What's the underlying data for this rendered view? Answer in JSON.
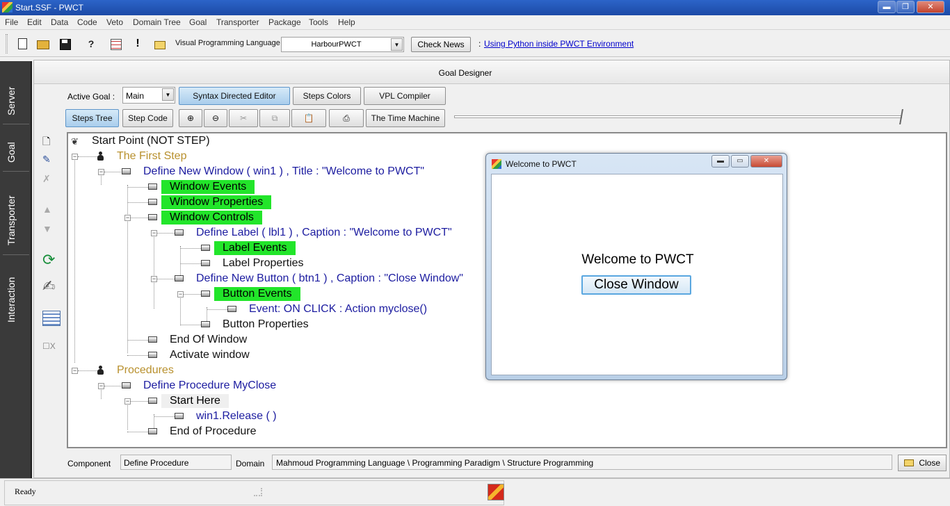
{
  "window": {
    "title": "Start.SSF  - PWCT",
    "min": "▬",
    "max": "❐",
    "close": "✕"
  },
  "menu": [
    "File",
    "Edit",
    "Data",
    "Code",
    "Veto",
    "Domain Tree",
    "Goal",
    "Transporter",
    "Package",
    "Tools",
    "Help"
  ],
  "toolbar": {
    "vpl_label": "Visual Programming Language",
    "vpl_value": "HarbourPWCT",
    "check_news": "Check News",
    "news_colon": ":",
    "news_link": "Using Python inside PWCT Environment"
  },
  "side_tabs": [
    "Server",
    "Goal",
    "Transporter",
    "Interaction"
  ],
  "goal_designer": {
    "title": "Goal Designer",
    "active_goal_label": "Active Goal :",
    "active_goal_value": "Main",
    "buttons_row1": [
      "Syntax Directed Editor",
      "Steps Colors",
      "VPL Compiler"
    ],
    "steps_tree": "Steps Tree",
    "step_code": "Step Code",
    "time_machine": "The Time Machine"
  },
  "tree": [
    {
      "text": "Start Point (NOT STEP)",
      "style": "black"
    },
    {
      "text": "The First Step",
      "style": "gold"
    },
    {
      "text": "Define New Window  ( win1 ) , Title : \"Welcome to PWCT\"",
      "style": "blue"
    },
    {
      "text": "Window Events",
      "style": "green"
    },
    {
      "text": "Window Properties",
      "style": "green"
    },
    {
      "text": "Window Controls",
      "style": "green"
    },
    {
      "text": "Define Label ( lbl1 ) , Caption : \"Welcome to PWCT\"",
      "style": "blue"
    },
    {
      "text": "Label Events",
      "style": "green"
    },
    {
      "text": "Label Properties",
      "style": "black"
    },
    {
      "text": "Define New Button ( btn1 ) , Caption : \"Close Window\"",
      "style": "blue"
    },
    {
      "text": "Button Events",
      "style": "green"
    },
    {
      "text": "Event: ON CLICK : Action myclose()",
      "style": "blue"
    },
    {
      "text": "Button Properties",
      "style": "black"
    },
    {
      "text": "End Of Window",
      "style": "black"
    },
    {
      "text": "Activate window",
      "style": "black"
    },
    {
      "text": "Procedures",
      "style": "gold"
    },
    {
      "text": "Define Procedure MyClose",
      "style": "blue"
    },
    {
      "text": "Start Here",
      "style": "grey"
    },
    {
      "text": "win1.Release ( )",
      "style": "blue"
    },
    {
      "text": "End of Procedure",
      "style": "black"
    }
  ],
  "component_bar": {
    "component_label": "Component",
    "component_value": "Define Procedure",
    "domain_label": "Domain",
    "domain_value": "Mahmoud Programming Language  \\  Programming Paradigm  \\  Structure Programming",
    "close": "Close"
  },
  "status": {
    "text": "Ready"
  },
  "welcome_window": {
    "title": "Welcome to PWCT",
    "label": "Welcome to PWCT",
    "button": "Close Window"
  }
}
